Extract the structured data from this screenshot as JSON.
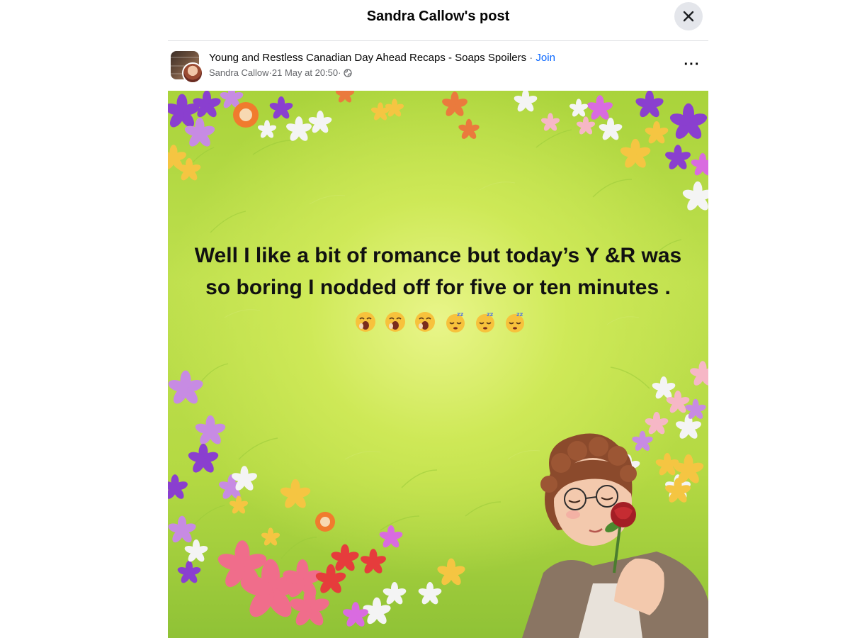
{
  "dialog": {
    "title": "Sandra Callow's post"
  },
  "post": {
    "group_name": "Young and Restless Canadian Day Ahead Recaps - Soaps Spoilers",
    "separator": " · ",
    "join_label": "Join",
    "author": "Sandra Callow",
    "timestamp": "21 May at 20:50",
    "more_label": "···",
    "text": "Well I like a bit of romance but today’s Y &R was so boring I nodded off for five or ten minutes .",
    "emojis": [
      "yawning-face",
      "yawning-face",
      "yawning-face",
      "sleeping-face",
      "sleeping-face",
      "sleeping-face"
    ]
  },
  "icons": {
    "close": "close-icon",
    "more": "more-options-icon",
    "privacy": "globe-icon"
  },
  "colors": {
    "link": "#0866ff",
    "secondary_text": "#65676b",
    "background_green": "#b4d943"
  }
}
